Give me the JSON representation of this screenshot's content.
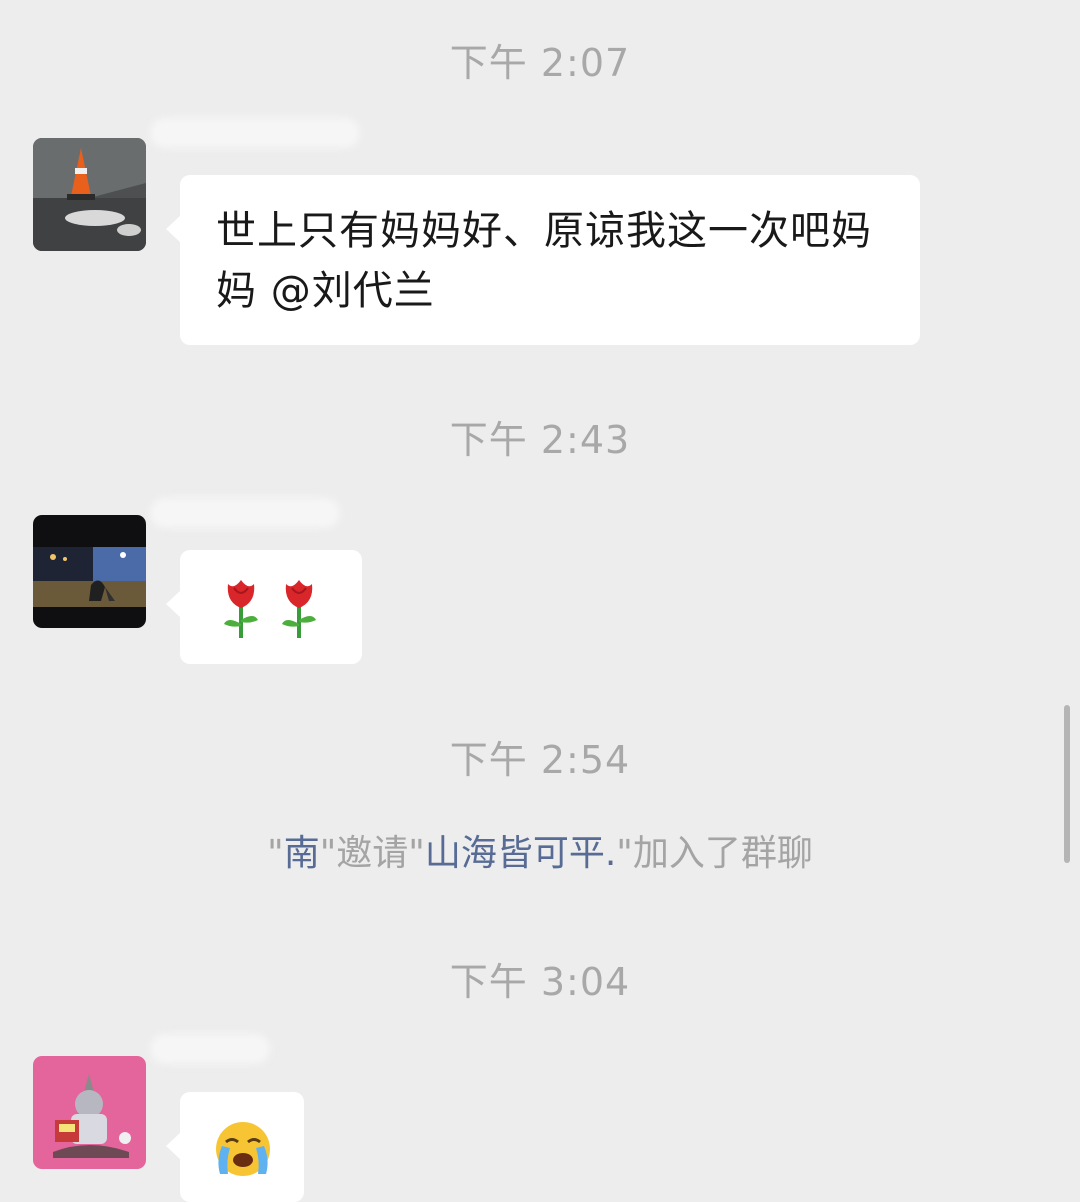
{
  "messages": [
    {
      "time": "下午 2:07",
      "text": "世上只有妈妈好、原谅我这一次吧妈妈 @刘代兰"
    },
    {
      "time": "下午 2:43",
      "emoji": "rose-emoji rose-emoji"
    },
    {
      "time": "下午 2:54"
    },
    {
      "time": "下午 3:04",
      "emoji": "loudly-crying-face-emoji"
    }
  ],
  "system_notice": {
    "quote1": "\"",
    "inviter": "南",
    "mid": "\"邀请\"",
    "invitee": "山海皆可平.",
    "suffix": "\"加入了群聊"
  },
  "colors": {
    "background": "#ededed",
    "bubble": "#ffffff",
    "link": "#576b95",
    "timestamp": "#a8a8a8"
  }
}
